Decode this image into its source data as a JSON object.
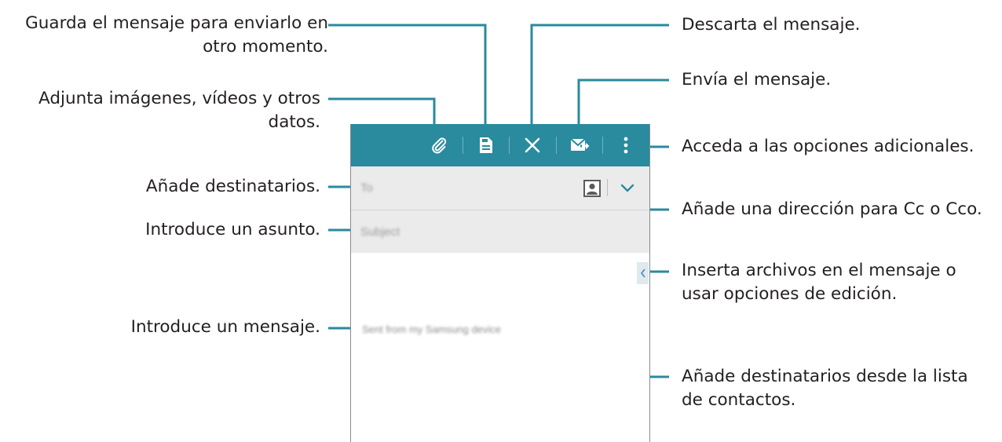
{
  "compose": {
    "to_placeholder": "To",
    "subject_placeholder": "Subject",
    "signature": "Sent from my Samsung device"
  },
  "callouts": {
    "save": "Guarda el mensaje para enviarlo en\notro momento.",
    "attach": "Adjunta imágenes, vídeos y otros\ndatos.",
    "recipients": "Añade destinatarios.",
    "subject": "Introduce un asunto.",
    "message": "Introduce un mensaje.",
    "discard": "Descarta el mensaje.",
    "send": "Envía el mensaje.",
    "more_options": "Acceda a las opciones adicionales.",
    "cc_bcc": "Añade una dirección para Cc o Cco.",
    "insert": "Inserta archivos en el mensaje o\nusar opciones de edición.",
    "contacts": "Añade destinatarios desde la lista\nde contactos."
  },
  "colors": {
    "action_bar": "#2a8a9e",
    "field_background": "#ebebeb",
    "callout_line": "#2a8a9e",
    "text": "#231f20"
  },
  "icons": {
    "attach": "paperclip-icon",
    "save": "save-draft-icon",
    "discard": "close-icon",
    "send": "send-mail-icon",
    "more": "overflow-menu-icon",
    "contacts": "contact-card-icon",
    "cc_bcc": "chevron-down-icon",
    "insert": "chevron-left-icon"
  }
}
